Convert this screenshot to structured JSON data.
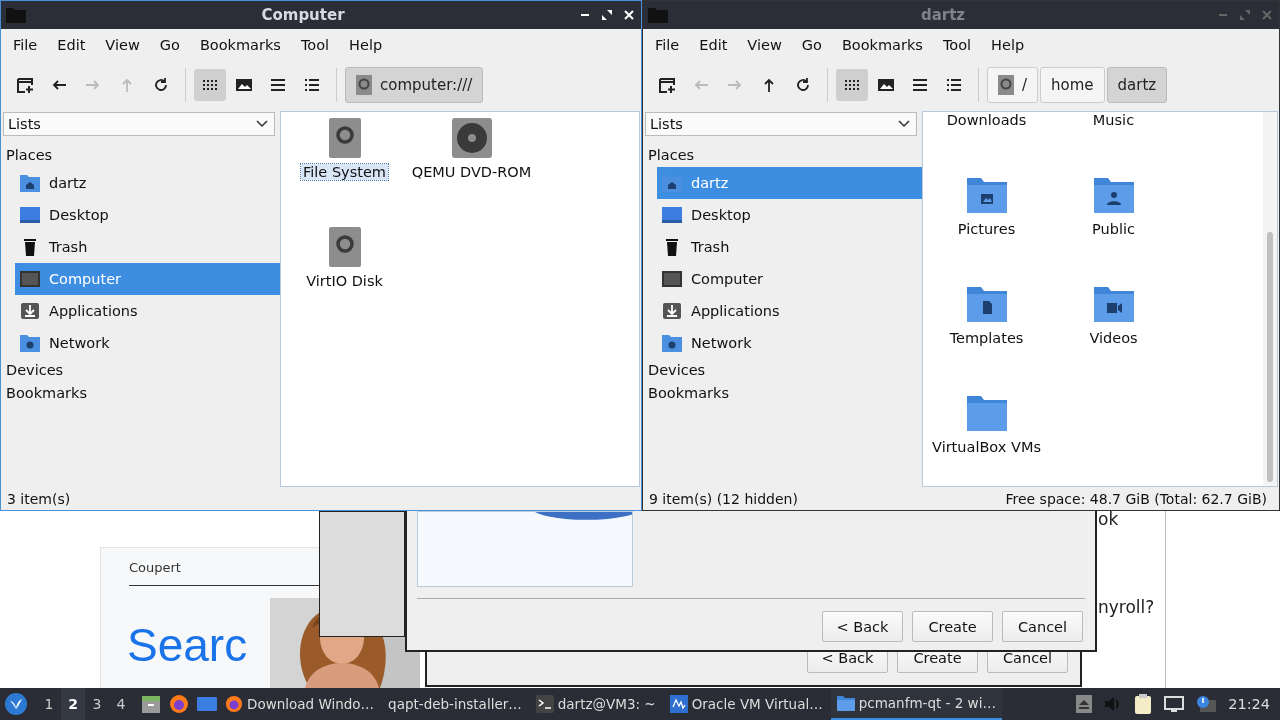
{
  "windows": [
    {
      "title": "Computer",
      "active": true,
      "menu": [
        "File",
        "Edit",
        "View",
        "Go",
        "Bookmarks",
        "Tool",
        "Help"
      ],
      "nav_buttons": [
        {
          "kind": "new-window",
          "disabled": false
        },
        {
          "kind": "back",
          "disabled": false
        },
        {
          "kind": "forward",
          "disabled": true
        },
        {
          "kind": "up",
          "disabled": true
        },
        {
          "kind": "reload",
          "disabled": false
        }
      ],
      "view_buttons": [
        {
          "kind": "icons",
          "selected": true
        },
        {
          "kind": "thumbnails",
          "selected": false
        },
        {
          "kind": "compact",
          "selected": false
        },
        {
          "kind": "details",
          "selected": false
        }
      ],
      "path": [
        {
          "label": "computer:///",
          "selected": true
        }
      ],
      "side_panel": {
        "dropdown": "Lists",
        "sections": [
          {
            "title": "Places",
            "items": [
              {
                "label": "dartz",
                "kind": "home",
                "selected": false
              },
              {
                "label": "Desktop",
                "kind": "desktop",
                "selected": false
              },
              {
                "label": "Trash",
                "kind": "trash",
                "selected": false
              },
              {
                "label": "Computer",
                "kind": "computer",
                "selected": true
              },
              {
                "label": "Applications",
                "kind": "applications",
                "selected": false
              },
              {
                "label": "Network",
                "kind": "network",
                "selected": false
              }
            ]
          },
          {
            "title": "Devices"
          },
          {
            "title": "Bookmarks"
          }
        ]
      },
      "files": [
        {
          "name": "File System",
          "kind": "drive",
          "selected": true
        },
        {
          "name": "QEMU DVD-ROM",
          "kind": "dvd",
          "selected": false
        },
        {
          "name": "VirtIO Disk",
          "kind": "drive",
          "selected": false
        }
      ],
      "status": [
        "3 item(s)"
      ]
    },
    {
      "title": "dartz",
      "active": false,
      "menu": [
        "File",
        "Edit",
        "View",
        "Go",
        "Bookmarks",
        "Tool",
        "Help"
      ],
      "nav_buttons": [
        {
          "kind": "new-window",
          "disabled": false
        },
        {
          "kind": "back",
          "disabled": true
        },
        {
          "kind": "forward",
          "disabled": true
        },
        {
          "kind": "up",
          "disabled": false
        },
        {
          "kind": "reload",
          "disabled": false
        }
      ],
      "view_buttons": [
        {
          "kind": "icons",
          "selected": true
        },
        {
          "kind": "thumbnails",
          "selected": false
        },
        {
          "kind": "compact",
          "selected": false
        },
        {
          "kind": "details",
          "selected": false
        }
      ],
      "path": [
        {
          "label": "/",
          "selected": false
        },
        {
          "label": "home",
          "selected": false
        },
        {
          "label": "dartz",
          "selected": true
        }
      ],
      "side_panel": {
        "dropdown": "Lists",
        "sections": [
          {
            "title": "Places",
            "items": [
              {
                "label": "dartz",
                "kind": "home",
                "selected": true
              },
              {
                "label": "Desktop",
                "kind": "desktop",
                "selected": false
              },
              {
                "label": "Trash",
                "kind": "trash",
                "selected": false
              },
              {
                "label": "Computer",
                "kind": "computer",
                "selected": false
              },
              {
                "label": "Applications",
                "kind": "applications",
                "selected": false
              },
              {
                "label": "Network",
                "kind": "network",
                "selected": false
              }
            ]
          },
          {
            "title": "Devices"
          },
          {
            "title": "Bookmarks"
          }
        ]
      },
      "files": [
        {
          "name": "Downloads",
          "kind": "folder-download",
          "selected": false
        },
        {
          "name": "Music",
          "kind": "folder-music",
          "selected": false
        },
        {
          "name": "Pictures",
          "kind": "folder-pictures",
          "selected": false
        },
        {
          "name": "Public",
          "kind": "folder-public",
          "selected": false
        },
        {
          "name": "Templates",
          "kind": "folder-templates",
          "selected": false
        },
        {
          "name": "Videos",
          "kind": "folder-videos",
          "selected": false
        },
        {
          "name": "VirtualBox VMs",
          "kind": "folder",
          "selected": false
        }
      ],
      "status": [
        "9 item(s) (12 hidden)",
        "Free space: 48.7 GiB (Total: 62.7 GiB)"
      ]
    }
  ],
  "background": {
    "web_page": {
      "brand": "Coupert",
      "heading": "Searc",
      "text_1": "ok",
      "text_2": "nyroll?"
    },
    "dialogs": [
      {
        "buttons": [
          "< Back",
          "Create",
          "Cancel"
        ]
      },
      {
        "buttons": [
          "< Back",
          "Create",
          "Cancel"
        ]
      }
    ]
  },
  "taskbar": {
    "workspaces": [
      {
        "label": "1",
        "selected": false
      },
      {
        "label": "2",
        "selected": true
      },
      {
        "label": "3",
        "selected": false
      },
      {
        "label": "4",
        "selected": false
      }
    ],
    "launchers": [
      {
        "kind": "files"
      },
      {
        "kind": "browser"
      },
      {
        "kind": "desktop"
      }
    ],
    "tasks": [
      {
        "label": "Download Windo…",
        "kind": "browser",
        "active": false
      },
      {
        "label": "qapt-deb-installer…",
        "kind": "plain",
        "active": false
      },
      {
        "label": "dartz@VM3: ~",
        "kind": "terminal",
        "active": false
      },
      {
        "label": "Oracle VM Virtual…",
        "kind": "vbox",
        "active": false
      },
      {
        "label": "pcmanfm-qt - 2 wi…",
        "kind": "folder",
        "active": true
      }
    ],
    "clock": "21:24"
  }
}
